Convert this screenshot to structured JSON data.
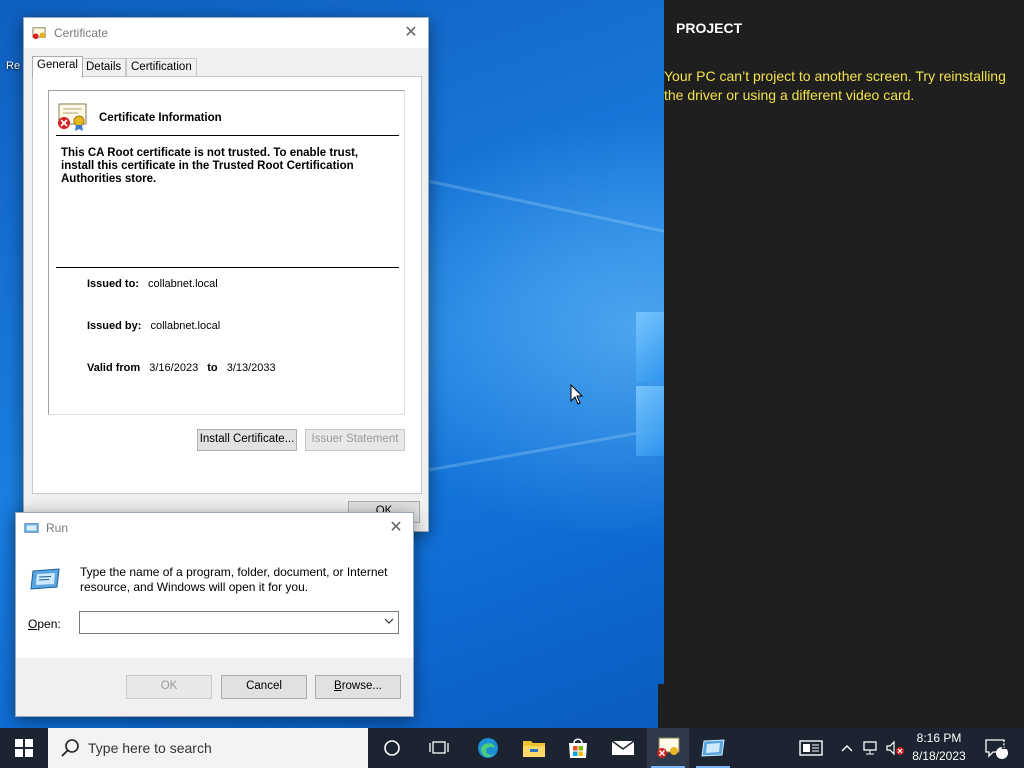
{
  "desktop": {
    "icon_label_fragment": "Re"
  },
  "project_panel": {
    "title": "PROJECT",
    "message": "Your PC can’t project to another screen. Try reinstalling the driver or using a different video card."
  },
  "certificate": {
    "window_title": "Certificate",
    "tabs": [
      "General",
      "Details",
      "Certification Path"
    ],
    "active_tab": "General",
    "heading": "Certificate Information",
    "warning": "This CA Root certificate is not trusted. To enable trust, install this certificate in the Trusted Root Certification Authorities store.",
    "issued_to_label": "Issued to:",
    "issued_to": "collabnet.local",
    "issued_by_label": "Issued by:",
    "issued_by": "collabnet.local",
    "valid_from_label": "Valid from",
    "valid_from": "3/16/2023",
    "valid_to_label": "to",
    "valid_to": "3/13/2033",
    "install_button": "Install Certificate...",
    "issuer_button": "Issuer Statement",
    "ok_button": "OK"
  },
  "run_dialog": {
    "window_title": "Run",
    "description": "Type the name of a program, folder, document, or Internet resource, and Windows will open it for you.",
    "open_label": "Open:",
    "open_value": "",
    "ok_button": "OK",
    "cancel_button": "Cancel",
    "browse_button": "Browse..."
  },
  "taskbar": {
    "search_placeholder": "Type here to search",
    "time": "8:16 PM",
    "date": "8/18/2023",
    "notification_count": "2"
  },
  "colors": {
    "project_bg": "#1f1f1f",
    "project_message": "#f0e24a",
    "taskbar_bg": "#1b2430",
    "desktop_blue": "#1a7fe0"
  }
}
